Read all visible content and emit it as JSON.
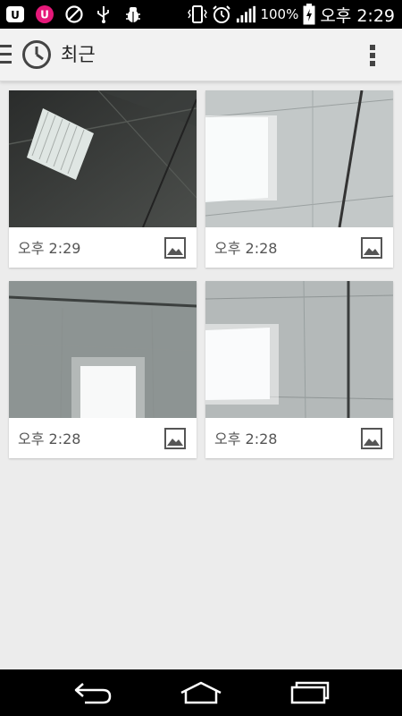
{
  "status_bar": {
    "battery_label": "100%",
    "clock": "오후 2:29",
    "icons": [
      "uplus-icon",
      "u-notification-icon",
      "blocked-icon",
      "usb-icon",
      "debug-icon",
      "vibrate-icon",
      "alarm-icon",
      "signal-icon",
      "battery-charging-icon"
    ]
  },
  "action_bar": {
    "title": "최근",
    "icons": [
      "drawer-icon",
      "clock-icon",
      "overflow-menu-icon"
    ]
  },
  "photos": [
    {
      "time": "오후 2:29",
      "type_icon": "image-icon"
    },
    {
      "time": "오후 2:28",
      "type_icon": "image-icon"
    },
    {
      "time": "오후 2:28",
      "type_icon": "image-icon"
    },
    {
      "time": "오후 2:28",
      "type_icon": "image-icon"
    }
  ],
  "nav_bar": {
    "icons": [
      "back-icon",
      "home-icon",
      "recent-apps-icon"
    ]
  },
  "colors": {
    "status_bar": "#000000",
    "action_bar": "#f2f2f2",
    "background": "#ececec",
    "notification_pink": "#e6197a"
  }
}
